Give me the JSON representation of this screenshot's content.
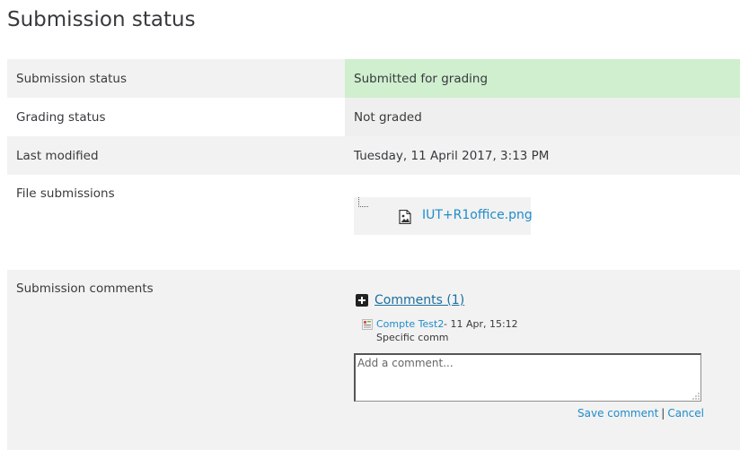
{
  "page": {
    "title": "Submission status"
  },
  "rows": {
    "submission_status": {
      "label": "Submission status",
      "value": "Submitted for grading"
    },
    "grading_status": {
      "label": "Grading status",
      "value": "Not graded"
    },
    "last_modified": {
      "label": "Last modified",
      "value": "Tuesday, 11 April 2017, 3:13 PM"
    },
    "file_submissions": {
      "label": "File submissions",
      "file_name": "IUT+R1office.png"
    },
    "submission_comments": {
      "label": "Submission comments"
    }
  },
  "comments": {
    "toggle_label": "Comments (1)",
    "items": [
      {
        "author": "Compte Test2",
        "meta": " - 11 Apr, 15:12",
        "text": "Specific comm"
      }
    ],
    "input_placeholder": "Add a comment...",
    "save_label": "Save comment",
    "separator": "|",
    "cancel_label": "Cancel"
  },
  "colors": {
    "submitted_bg": "#cfefcf",
    "link": "#1f8cc9"
  },
  "icons": {
    "file": "image-file-icon",
    "toggle": "plus-square-icon",
    "avatar": "user-avatar-icon"
  }
}
